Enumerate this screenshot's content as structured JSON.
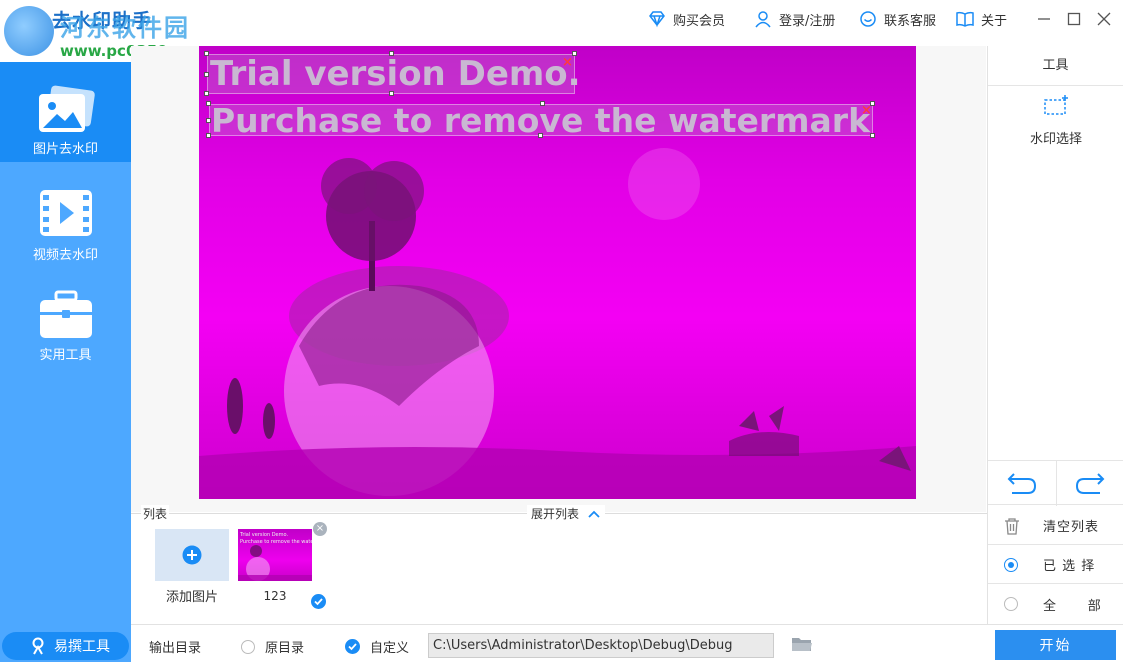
{
  "app": {
    "title": "去水印助手",
    "watermark_site": "河东软件园",
    "watermark_url": "www.pc0359.cn"
  },
  "header": {
    "buy_vip": "购买会员",
    "login": "登录/注册",
    "contact": "联系客服",
    "about": "关于"
  },
  "sidebar": {
    "items": [
      {
        "label": "图片去水印",
        "icon": "image-icon",
        "active": true
      },
      {
        "label": "视频去水印",
        "icon": "video-icon",
        "active": false
      },
      {
        "label": "实用工具",
        "icon": "toolbox-icon",
        "active": false
      }
    ],
    "bottom_label": "易撰工具"
  },
  "canvas": {
    "watermark_line1": "Trial version Demo.",
    "watermark_line2": "Purchase to remove the watermark"
  },
  "tools": {
    "title": "工具",
    "watermark_select": "水印选择",
    "clear_list": "清空列表",
    "selected": "已 选 择",
    "all": "全      部",
    "selected_checked": true
  },
  "list": {
    "label": "列表",
    "expand": "展开列表",
    "add_image": "添加图片",
    "items": [
      {
        "name": "123",
        "checked": true
      }
    ]
  },
  "bottom": {
    "output_dir": "输出目录",
    "original_dir": "原目录",
    "custom": "自定义",
    "path": "C:\\Users\\Administrator\\Desktop\\Debug\\Debug",
    "start": "开始",
    "custom_checked": true
  },
  "colors": {
    "sidebar_bg": "#4da8ff",
    "sidebar_active": "#1a8cf5",
    "accent": "#2b8ff0",
    "canvas_magenta": "#f000f0"
  }
}
